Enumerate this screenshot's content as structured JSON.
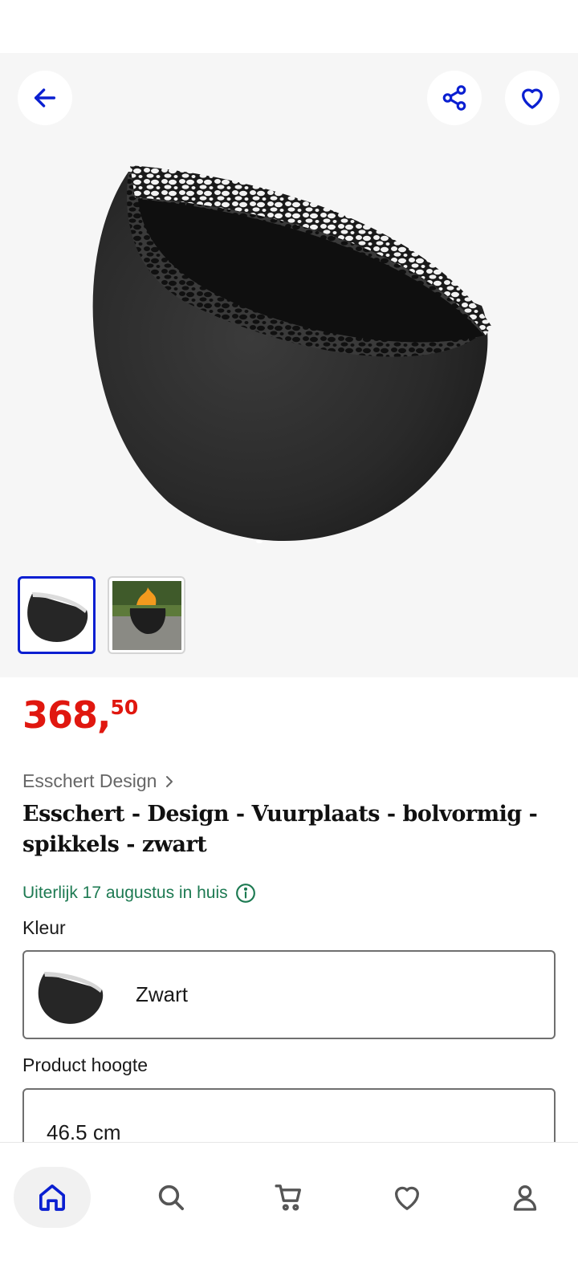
{
  "header": {
    "back_icon": "arrow-left-icon",
    "share_icon": "share-icon",
    "favorite_icon": "heart-icon"
  },
  "gallery": {
    "thumbnails": [
      {
        "icon": "fire-bowl-product-thumb",
        "active": true
      },
      {
        "icon": "fire-bowl-garden-thumb",
        "active": false
      }
    ]
  },
  "product": {
    "price_main": "368,",
    "price_fraction": "50",
    "brand": "Esschert Design",
    "title": "Esschert - Design - Vuurplaats - bolvormig - spikkels - zwart",
    "delivery": "Uiterlijk 17 augustus in huis"
  },
  "options": {
    "color_label": "Kleur",
    "color_value": "Zwart",
    "height_label": "Product hoogte",
    "height_value": "46.5 cm"
  },
  "nav": {
    "items": [
      {
        "icon": "home-icon",
        "active": true
      },
      {
        "icon": "search-icon",
        "active": false
      },
      {
        "icon": "cart-icon",
        "active": false
      },
      {
        "icon": "heart-icon",
        "active": false
      },
      {
        "icon": "account-icon",
        "active": false
      }
    ]
  },
  "colors": {
    "accent": "#0a1fd1",
    "price": "#e0170f",
    "delivery": "#1d7a52"
  }
}
